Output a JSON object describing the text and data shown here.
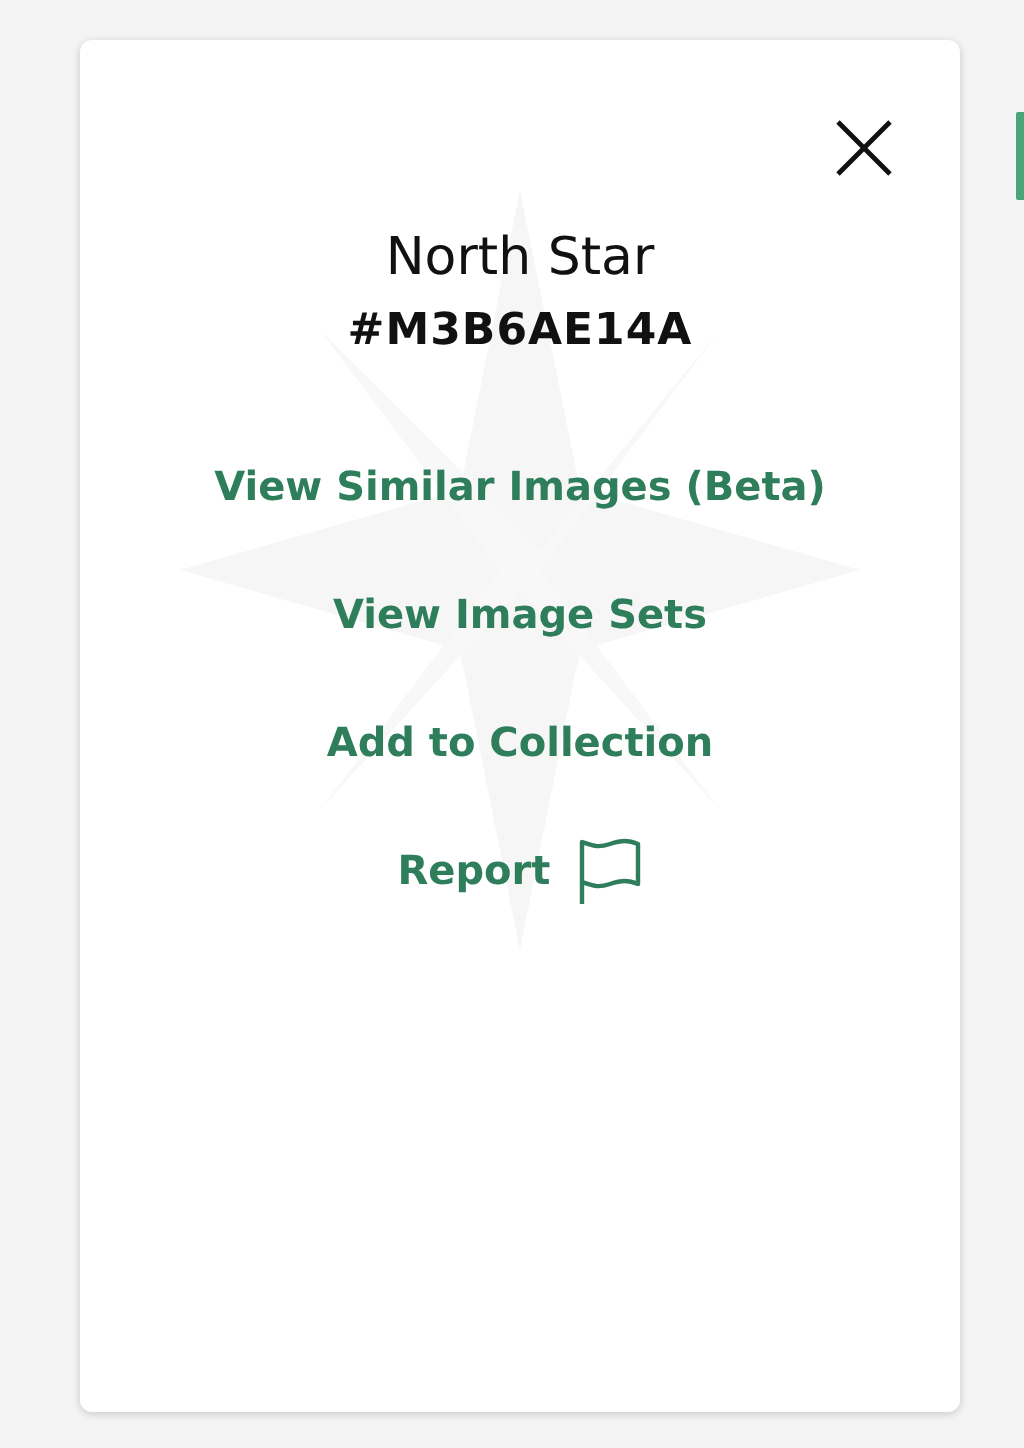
{
  "dialog": {
    "title": "North Star",
    "code": "#M3B6AE14A",
    "actions": [
      {
        "label": "View Similar Images (Beta)",
        "kind": "link"
      },
      {
        "label": "View Image Sets",
        "kind": "link"
      },
      {
        "label": "Add to Collection",
        "kind": "link"
      },
      {
        "label": "Report",
        "kind": "report"
      }
    ]
  }
}
